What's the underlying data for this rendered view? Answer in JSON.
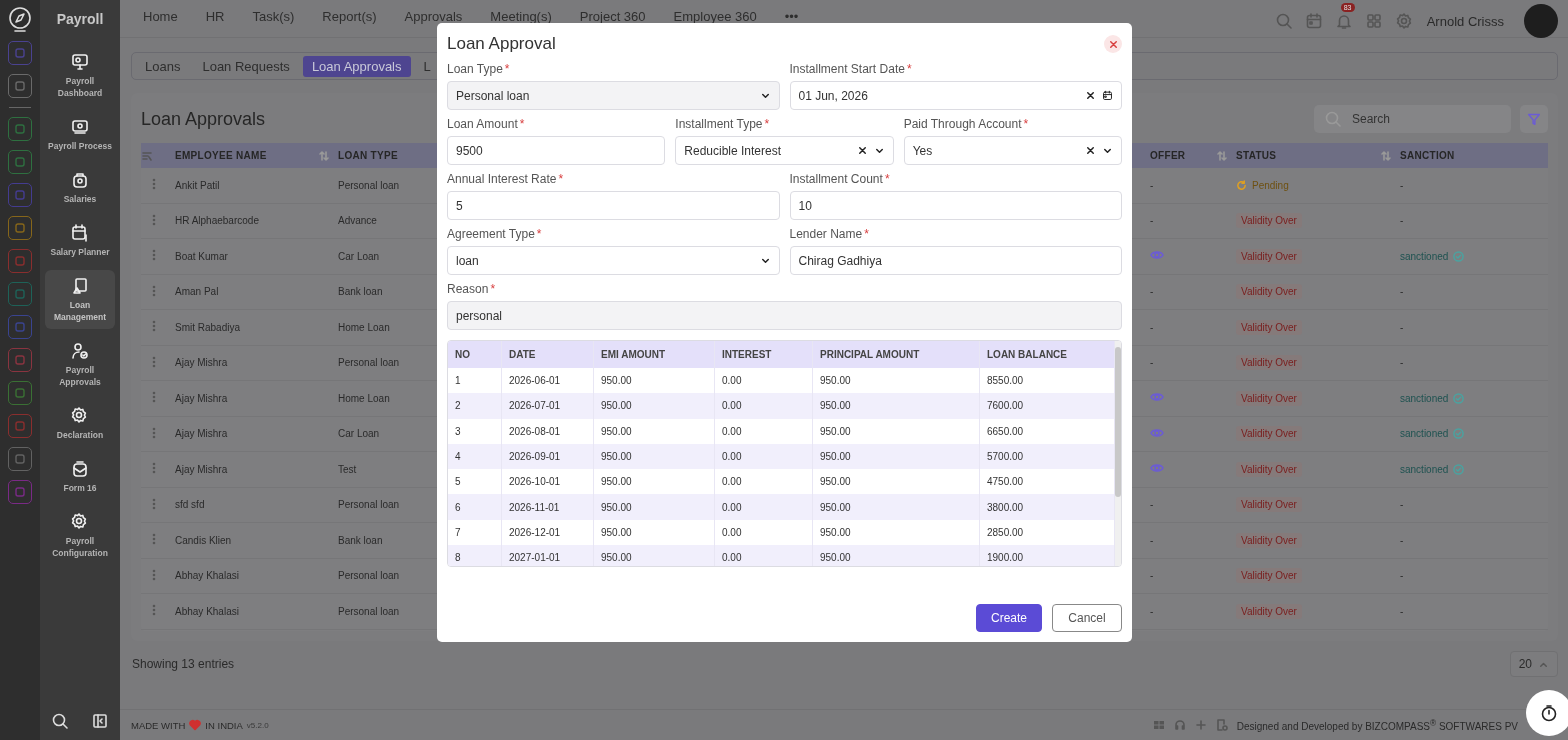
{
  "app": {
    "title": "Payroll"
  },
  "rail": [
    {
      "color": "#4a4290"
    },
    {
      "color": "#6a6a6a"
    },
    {
      "color": "#2e7040"
    },
    {
      "color": "#2e7040"
    },
    {
      "color": "#443c90"
    },
    {
      "color": "#86661a"
    },
    {
      "color": "#8a2e2e"
    },
    {
      "color": "#1e6258"
    },
    {
      "color": "#3a4490"
    },
    {
      "color": "#8a3440"
    },
    {
      "color": "#3a7034"
    },
    {
      "color": "#8a2e2e"
    },
    {
      "color": "#626262"
    },
    {
      "color": "#7a2a86"
    }
  ],
  "sidebar": {
    "items": [
      {
        "label": "Payroll Dashboard",
        "selected": false
      },
      {
        "label": "Payroll Process",
        "selected": false
      },
      {
        "label": "Salaries",
        "selected": false
      },
      {
        "label": "Salary Planner",
        "selected": false
      },
      {
        "label": "Loan Management",
        "selected": true
      },
      {
        "label": "Payroll Approvals",
        "selected": false
      },
      {
        "label": "Declaration",
        "selected": false
      },
      {
        "label": "Form 16",
        "selected": false
      },
      {
        "label": "Payroll Configuration",
        "selected": false
      }
    ]
  },
  "topnav": {
    "items": [
      "Home",
      "HR",
      "Task(s)",
      "Report(s)",
      "Approvals",
      "Meeting(s)",
      "Project 360",
      "Employee 360",
      "•••"
    ],
    "notification_count": "83",
    "user": "Arnold Crisss"
  },
  "subtabs": [
    {
      "label": "Loans",
      "selected": false
    },
    {
      "label": "Loan Requests",
      "selected": false
    },
    {
      "label": "Loan Approvals",
      "selected": true
    },
    {
      "label": "L",
      "selected": false
    }
  ],
  "page": {
    "title": "Loan Approvals",
    "search": {
      "placeholder": "Search"
    }
  },
  "table": {
    "left_columns": [
      {
        "label": "EMPLOYEE NAME",
        "sortable": true
      },
      {
        "label": "LOAN TYPE",
        "sortable": false
      }
    ],
    "right_columns": [
      {
        "label": "OFFER",
        "sortable": true
      },
      {
        "label": "STATUS",
        "sortable": true
      },
      {
        "label": "SANCTION",
        "sortable": false
      }
    ],
    "rows": [
      {
        "name": "Ankit Patil",
        "loan_type": "Personal loan",
        "offer": {
          "kind": "dash",
          "text": "-"
        },
        "status": {
          "kind": "pending",
          "text": "Pending"
        },
        "sanction": {
          "kind": "dash",
          "text": "-"
        }
      },
      {
        "name": "HR Alphaebarcode",
        "loan_type": "Advance",
        "offer": {
          "kind": "dash",
          "text": "-"
        },
        "status": {
          "kind": "over",
          "text": "Validity Over"
        },
        "sanction": {
          "kind": "dash",
          "text": "-"
        }
      },
      {
        "name": "Boat Kumar",
        "loan_type": "Car Loan",
        "offer": {
          "kind": "view"
        },
        "status": {
          "kind": "over",
          "text": "Validity Over"
        },
        "sanction": {
          "kind": "sanctioned",
          "text": "sanctioned"
        }
      },
      {
        "name": "Aman Pal",
        "loan_type": "Bank loan",
        "offer": {
          "kind": "dash",
          "text": "-"
        },
        "status": {
          "kind": "over",
          "text": "Validity Over"
        },
        "sanction": {
          "kind": "dash",
          "text": "-"
        }
      },
      {
        "name": "Smit Rabadiya",
        "loan_type": "Home Loan",
        "offer": {
          "kind": "dash",
          "text": "-"
        },
        "status": {
          "kind": "over",
          "text": "Validity Over"
        },
        "sanction": {
          "kind": "dash",
          "text": "-"
        }
      },
      {
        "name": "Ajay Mishra",
        "loan_type": "Personal loan",
        "offer": {
          "kind": "dash",
          "text": "-"
        },
        "status": {
          "kind": "over",
          "text": "Validity Over"
        },
        "sanction": {
          "kind": "dash",
          "text": "-"
        }
      },
      {
        "name": "Ajay Mishra",
        "loan_type": "Home Loan",
        "offer": {
          "kind": "view"
        },
        "status": {
          "kind": "over",
          "text": "Validity Over"
        },
        "sanction": {
          "kind": "sanctioned",
          "text": "sanctioned"
        }
      },
      {
        "name": "Ajay Mishra",
        "loan_type": "Car Loan",
        "offer": {
          "kind": "view"
        },
        "status": {
          "kind": "over",
          "text": "Validity Over"
        },
        "sanction": {
          "kind": "sanctioned",
          "text": "sanctioned"
        }
      },
      {
        "name": "Ajay Mishra",
        "loan_type": "Test",
        "offer": {
          "kind": "view"
        },
        "status": {
          "kind": "over",
          "text": "Validity Over"
        },
        "sanction": {
          "kind": "sanctioned",
          "text": "sanctioned"
        }
      },
      {
        "name": "sfd sfd",
        "loan_type": "Personal loan",
        "offer": {
          "kind": "dash",
          "text": "-"
        },
        "status": {
          "kind": "over",
          "text": "Validity Over"
        },
        "sanction": {
          "kind": "dash",
          "text": "-"
        }
      },
      {
        "name": "Candis Klien",
        "loan_type": "Bank loan",
        "offer": {
          "kind": "dash",
          "text": "-"
        },
        "status": {
          "kind": "over",
          "text": "Validity Over"
        },
        "sanction": {
          "kind": "dash",
          "text": "-"
        }
      },
      {
        "name": "Abhay Khalasi",
        "loan_type": "Personal loan",
        "offer": {
          "kind": "dash",
          "text": "-"
        },
        "status": {
          "kind": "over",
          "text": "Validity Over"
        },
        "sanction": {
          "kind": "dash",
          "text": "-"
        }
      },
      {
        "name": "Abhay Khalasi",
        "loan_type": "Personal loan",
        "offer": {
          "kind": "dash",
          "text": "-"
        },
        "status": {
          "kind": "over",
          "text": "Validity Over"
        },
        "sanction": {
          "kind": "dash",
          "text": "-"
        }
      }
    ]
  },
  "pagination": {
    "entries": "Showing 13 entries",
    "page_size": "20"
  },
  "status_bar": {
    "made_with": "MADE WITH",
    "in_india": "IN INDIA",
    "version": "v5.2.0",
    "credit": "Designed and Developed by  BIZCOMPASS$^{®}$ SOFTWARES PV"
  },
  "dialog": {
    "title": "Loan Approval",
    "field_rows": [
      [
        {
          "label": "Loan Type",
          "required_mark": "*",
          "kind": "select",
          "value": "Personal loan",
          "disabled": true,
          "clearable": false
        },
        {
          "label": "Installment Start Date",
          "required_mark": "*",
          "kind": "date",
          "value": "01 Jun, 2026",
          "disabled": false,
          "clearable": true
        }
      ],
      [
        {
          "label": "Loan Amount",
          "required_mark": "*",
          "kind": "text",
          "value": "9500",
          "disabled": false,
          "clearable": false
        },
        {
          "label": "Installment Type",
          "required_mark": "*",
          "kind": "select",
          "value": "Reducible Interest",
          "disabled": false,
          "clearable": true
        },
        {
          "label": "Paid Through Account",
          "required_mark": "*",
          "kind": "select",
          "value": "Yes",
          "disabled": false,
          "clearable": true
        }
      ],
      [
        {
          "label": "Annual Interest Rate",
          "required_mark": "*",
          "kind": "text",
          "value": "5",
          "disabled": false,
          "clearable": false
        },
        {
          "label": "Installment Count",
          "required_mark": "*",
          "kind": "text",
          "value": "10",
          "disabled": false,
          "clearable": false
        }
      ],
      [
        {
          "label": "Agreement Type",
          "required_mark": "*",
          "kind": "select",
          "value": "loan",
          "disabled": false,
          "clearable": false
        },
        {
          "label": "Lender Name",
          "required_mark": "*",
          "kind": "text",
          "value": "Chirag Gadhiya",
          "disabled": false,
          "clearable": false
        }
      ],
      [
        {
          "label": "Reason",
          "required_mark": "*",
          "kind": "text",
          "value": "personal",
          "disabled": true,
          "clearable": false
        }
      ]
    ],
    "schedule": {
      "columns": [
        "NO",
        "DATE",
        "EMI AMOUNT",
        "INTEREST",
        "PRINCIPAL AMOUNT",
        "LOAN BALANCE"
      ],
      "rows": [
        [
          "1",
          "2026-06-01",
          "950.00",
          "0.00",
          "950.00",
          "8550.00"
        ],
        [
          "2",
          "2026-07-01",
          "950.00",
          "0.00",
          "950.00",
          "7600.00"
        ],
        [
          "3",
          "2026-08-01",
          "950.00",
          "0.00",
          "950.00",
          "6650.00"
        ],
        [
          "4",
          "2026-09-01",
          "950.00",
          "0.00",
          "950.00",
          "5700.00"
        ],
        [
          "5",
          "2026-10-01",
          "950.00",
          "0.00",
          "950.00",
          "4750.00"
        ],
        [
          "6",
          "2026-11-01",
          "950.00",
          "0.00",
          "950.00",
          "3800.00"
        ],
        [
          "7",
          "2026-12-01",
          "950.00",
          "0.00",
          "950.00",
          "2850.00"
        ],
        [
          "8",
          "2027-01-01",
          "950.00",
          "0.00",
          "950.00",
          "1900.00"
        ]
      ]
    },
    "buttons": [
      {
        "label": "Create",
        "kind": "primary"
      },
      {
        "label": "Cancel",
        "kind": "secondary"
      }
    ]
  }
}
